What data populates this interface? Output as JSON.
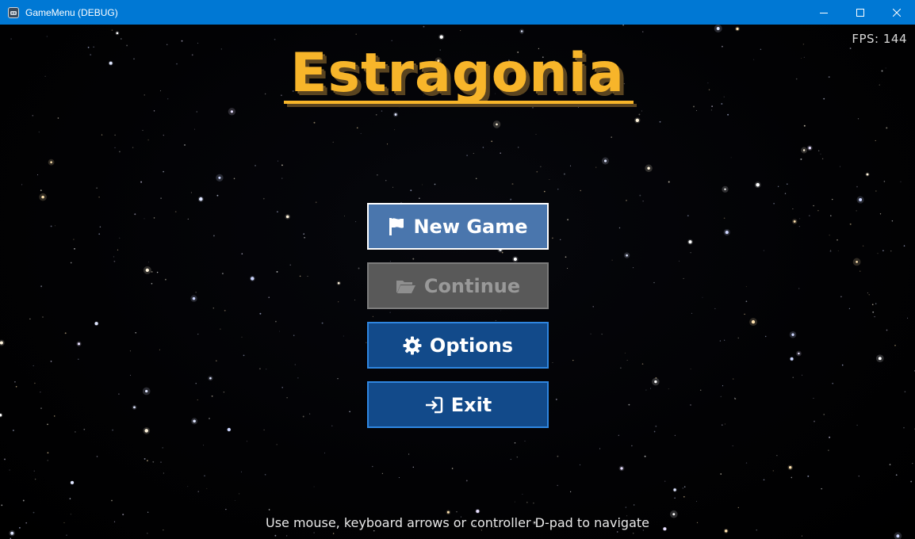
{
  "window": {
    "title": "GameMenu (DEBUG)",
    "minimize_icon": "minimize-icon",
    "maximize_icon": "maximize-icon",
    "close_icon": "close-icon",
    "titlebar_color": "#0078d4"
  },
  "hud": {
    "fps_text": "FPS: 144"
  },
  "game": {
    "title": "Estragonia",
    "title_color": "#f7b52a"
  },
  "menu": {
    "new_game": {
      "label": "New Game",
      "icon": "flag-icon",
      "state": "focused"
    },
    "continue": {
      "label": "Continue",
      "icon": "folder-open-icon",
      "state": "disabled"
    },
    "options": {
      "label": "Options",
      "icon": "gear-icon",
      "state": "normal"
    },
    "exit": {
      "label": "Exit",
      "icon": "exit-icon",
      "state": "normal"
    }
  },
  "footer": {
    "hint": "Use mouse, keyboard arrows or controller D-pad to navigate"
  },
  "colors": {
    "focused_button_bg": "#4a76ad",
    "normal_button_bg": "#124a8a",
    "normal_button_border": "#2f86e0",
    "disabled_button_bg": "#595959"
  }
}
